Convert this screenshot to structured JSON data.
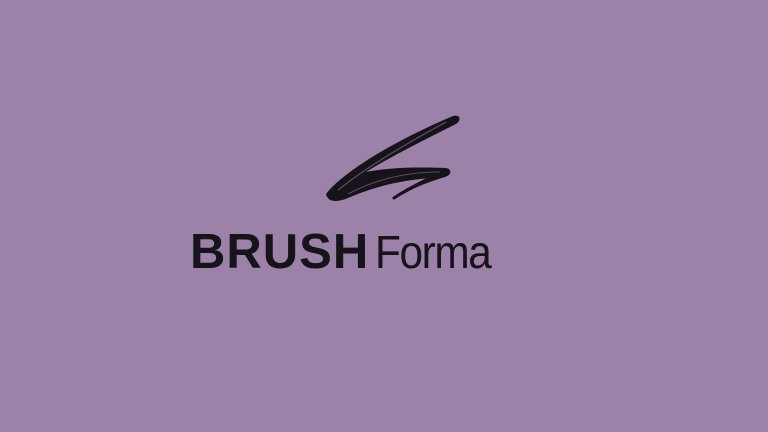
{
  "logo": {
    "mark_icon": "brush-stroke-icon",
    "word_bold": "BRUSH",
    "word_light": "Forma"
  },
  "colors": {
    "background": "#9c81a8",
    "ink": "#17131a"
  }
}
